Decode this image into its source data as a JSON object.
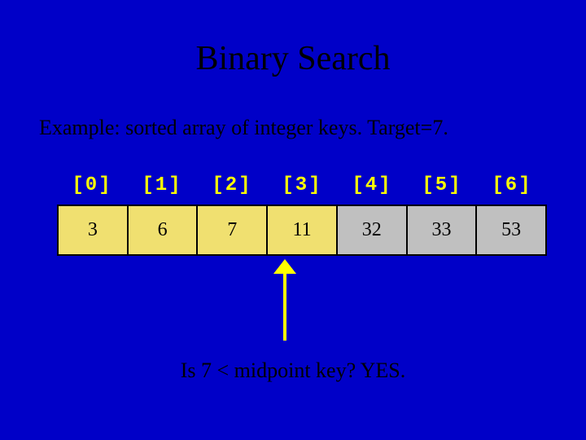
{
  "title": "Binary Search",
  "subtitle": "Example: sorted array of integer keys.  Target=7.",
  "array": {
    "indices": [
      "[0]",
      "[1]",
      "[2]",
      "[3]",
      "[4]",
      "[5]",
      "[6]"
    ],
    "values": [
      "3",
      "6",
      "7",
      "11",
      "32",
      "33",
      "53"
    ],
    "highlight_yellow": [
      0,
      1,
      2
    ],
    "highlight_pointer": 3,
    "plain": [
      4,
      5,
      6
    ]
  },
  "question": "Is 7 < midpoint key? YES.",
  "colors": {
    "background": "#0000c8",
    "index_text": "#ffff00",
    "arrow": "#ffff00",
    "highlight": "#f0e070",
    "cell_normal": "#c0c0c0"
  }
}
